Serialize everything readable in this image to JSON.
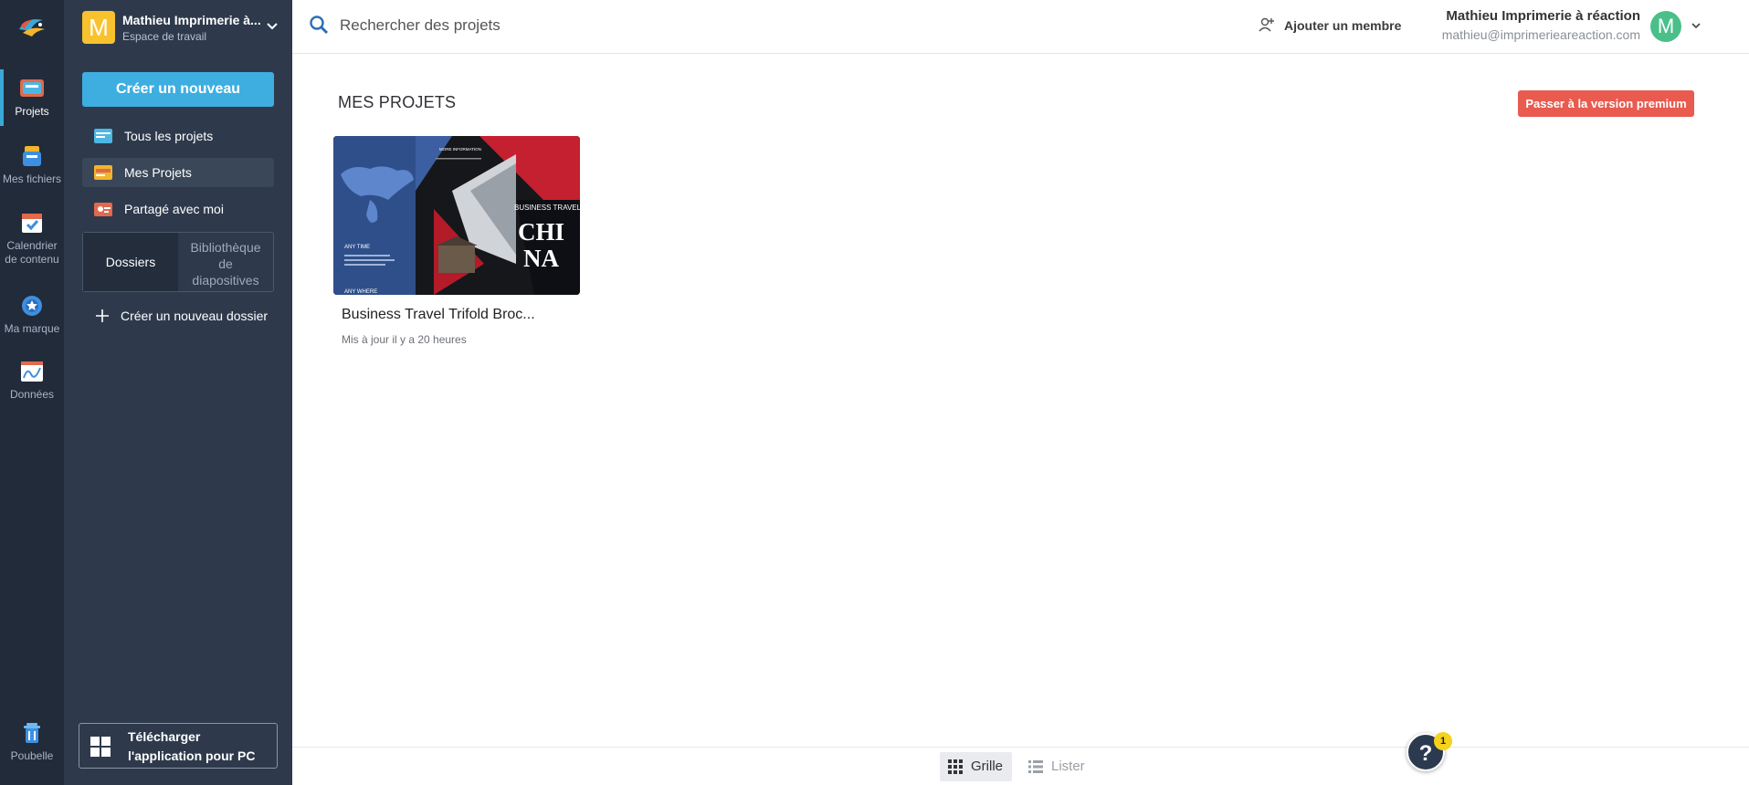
{
  "rail": {
    "items": [
      {
        "label": "Projets",
        "icon": "projects-icon"
      },
      {
        "label": "Mes fichiers",
        "icon": "files-icon"
      },
      {
        "label_line1": "Calendrier",
        "label_line2": "de contenu",
        "icon": "calendar-icon"
      },
      {
        "label": "Ma marque",
        "icon": "brand-icon"
      },
      {
        "label": "Données",
        "icon": "data-icon"
      }
    ],
    "trash_label": "Poubelle"
  },
  "workspace": {
    "avatar_letter": "M",
    "name": "Mathieu Imprimerie à...",
    "subtitle": "Espace de travail"
  },
  "sidebar": {
    "create_label": "Créer un nouveau",
    "nav": [
      {
        "label": "Tous les projets"
      },
      {
        "label": "Mes Projets"
      },
      {
        "label": "Partagé avec moi"
      }
    ],
    "segment": {
      "left": "Dossiers",
      "right_line1": "Bibliothèque",
      "right_line2": "de",
      "right_line3": "diapositives"
    },
    "new_folder_label": "Créer un nouveau dossier",
    "download_line1": "Télécharger",
    "download_line2": "l'application pour PC"
  },
  "header": {
    "search_placeholder": "Rechercher des projets",
    "add_member_label": "Ajouter un membre",
    "user_name": "Mathieu Imprimerie à réaction",
    "user_email": "mathieu@imprimerieareaction.com",
    "user_avatar_letter": "M"
  },
  "content": {
    "section_title": "MES PROJETS",
    "premium_label": "Passer à la version premium",
    "projects": [
      {
        "title": "Business Travel Trifold Broc...",
        "updated": "Mis à jour il y a 20 heures",
        "thumb": {
          "more_info": "MORE INFORMATION",
          "headline": "BUSINESS TRAVEL TO",
          "big_line1": "CHI",
          "big_line2": "NA",
          "any_time": "ANY TIME",
          "any_where": "ANY WHERE"
        }
      }
    ]
  },
  "footer": {
    "grid_label": "Grille",
    "list_label": "Lister"
  },
  "help": {
    "symbol": "?",
    "badge": "1"
  },
  "colors": {
    "rail_bg": "#222b3a",
    "sidebar_bg": "#2e3a4c",
    "accent": "#3eaee0",
    "premium": "#e95a4f",
    "avatar_green": "#4bbf8a",
    "workspace_yellow": "#f8c22e"
  }
}
